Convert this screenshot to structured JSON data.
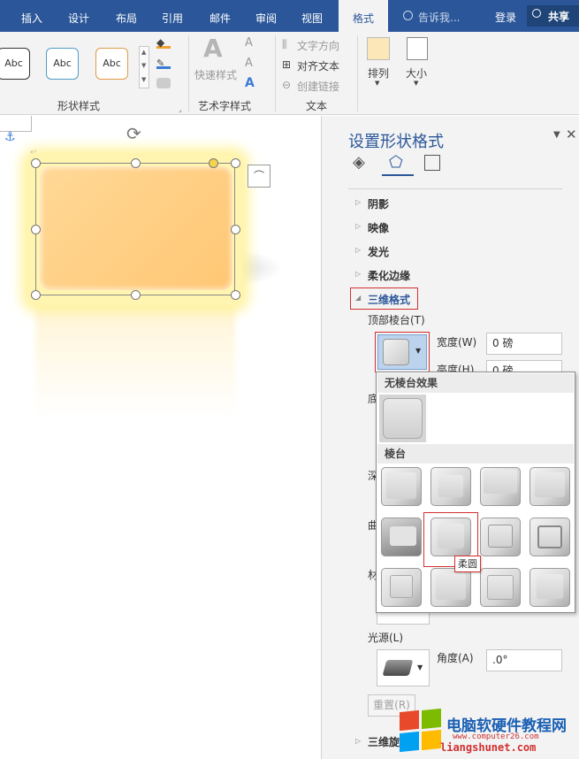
{
  "tabs": [
    "插入",
    "设计",
    "布局",
    "引用",
    "邮件",
    "审阅",
    "视图",
    "格式"
  ],
  "active_tab": "格式",
  "tell_me": "告诉我...",
  "login": "登录",
  "share": "共享",
  "ribbon": {
    "shape_style_sample": "Abc",
    "shape_styles_label": "形状样式",
    "quick_styles": "快速样式",
    "wordart_label": "艺术字样式",
    "text_direction": "文字方向",
    "align_text": "对齐文本",
    "create_link": "创建链接",
    "text_group_label": "文本",
    "arrange": "排列",
    "size": "大小",
    "wordart_letter": "A"
  },
  "pane": {
    "title": "设置形状格式",
    "sections": [
      "阴影",
      "映像",
      "发光",
      "柔化边缘",
      "三维格式"
    ],
    "top_bevel": "顶部棱台(T)",
    "width_label": "宽度(W)",
    "width_value": "0 磅",
    "height_label": "高度(H)",
    "height_value": "0 磅",
    "hidden_labels": [
      "底",
      "深",
      "曲",
      "材"
    ],
    "light_label": "光源(L)",
    "angle_label": "角度(A)",
    "angle_value": ".0°",
    "reset": "重置(R)",
    "rotation_section": "三维旋"
  },
  "gallery": {
    "no_bevel": "无棱台效果",
    "bevel_header": "棱台",
    "tooltip": "柔圆"
  },
  "watermark": {
    "title": "电脑软硬件教程网",
    "url": "www.computer26.com",
    "url2": "liangshunet.com"
  },
  "colors": {
    "ribbon_blue": "#2b579a",
    "shape_fill": "#ffcc80",
    "highlight_red": "#d23030"
  }
}
